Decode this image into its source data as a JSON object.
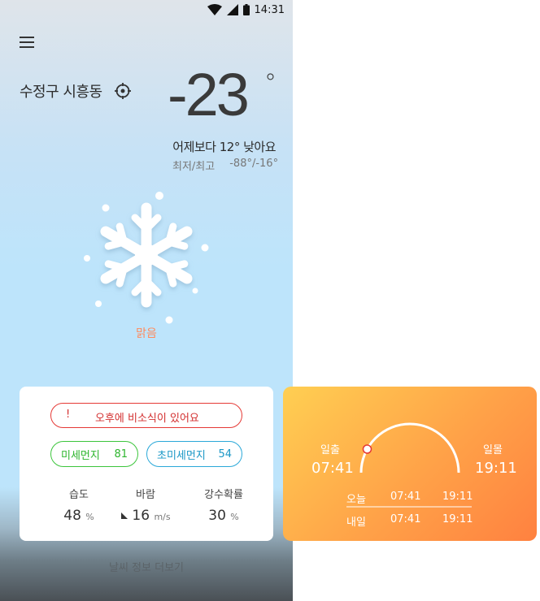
{
  "status": {
    "time": "14:31"
  },
  "location": {
    "name": "수정구 시흥동"
  },
  "current": {
    "temp": "-23",
    "degree": "°",
    "compare": "어제보다 12° 낮아요",
    "minmax_label": "최저/최고",
    "minmax_value": "-88°/-16°",
    "condition": "맑음",
    "icon": "snowflake-icon"
  },
  "card": {
    "alert_icon": "!",
    "alert_text": "오후에 비소식이 있어요",
    "pm10_label": "미세먼지",
    "pm10_value": "81",
    "pm25_label": "초미세먼지",
    "pm25_value": "54",
    "humidity_label": "습도",
    "humidity_value": "48",
    "humidity_unit": "%",
    "wind_label": "바람",
    "wind_value": "16",
    "wind_unit": "m/s",
    "rain_label": "강수확률",
    "rain_value": "30",
    "rain_unit": "%"
  },
  "more_link": "날씨 정보 더보기",
  "sun": {
    "sunrise_label": "일출",
    "sunrise_time": "07:41",
    "sunset_label": "일몰",
    "sunset_time": "19:11",
    "today_label": "오늘",
    "today_rise": "07:41",
    "today_set": "19:11",
    "tomorrow_label": "내일",
    "tomorrow_rise": "07:41",
    "tomorrow_set": "19:11"
  },
  "colors": {
    "alert": "#e53935",
    "pm10": "#3cc53c",
    "pm25": "#2aa8d8",
    "condition": "#ff8a5c",
    "sun_card_start": "#ffcf52",
    "sun_card_end": "#ff8140"
  }
}
